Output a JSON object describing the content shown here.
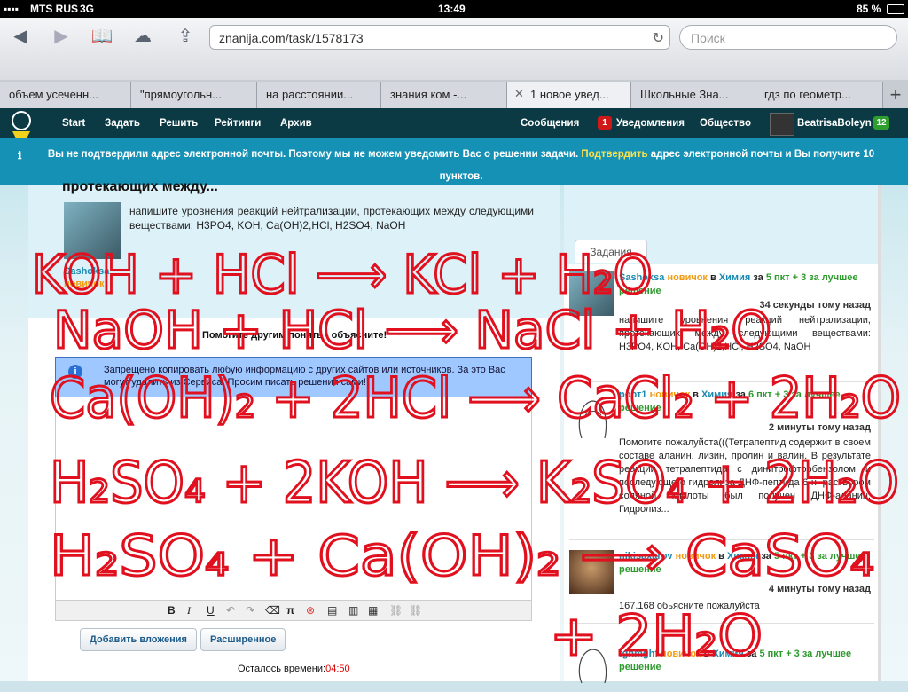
{
  "status_bar": {
    "carrier": "MTS RUS",
    "network": "3G",
    "time": "13:49",
    "battery": "85 %"
  },
  "browser": {
    "url": "znanija.com/task/1578173",
    "search_placeholder": "Поиск",
    "tabs": [
      {
        "label": "объем усеченн..."
      },
      {
        "label": "\"прямоугольн..."
      },
      {
        "label": "на расстоянии..."
      },
      {
        "label": "знания ком -..."
      },
      {
        "label": "1 новое увед..."
      },
      {
        "label": "Школьные Зна..."
      },
      {
        "label": "гдз по геометр..."
      }
    ],
    "add_tab": "+"
  },
  "site_nav": {
    "items": [
      "Start",
      "Задать",
      "Решить",
      "Рейтинги",
      "Архив"
    ],
    "messages": "Сообщения",
    "notifications_count": "1",
    "notifications": "Уведомления",
    "community": "Общество",
    "username": "BeatrisaBoleyn",
    "points": "12"
  },
  "alert": {
    "text_before": "Вы не подтвердили адрес электронной почты. Поэтому мы не можем уведомить Вас о решении задачи.",
    "link": "Подтвердить",
    "text_after": "адрес электронной почты и Вы получите 10 пунктов."
  },
  "question": {
    "title": "протекающих между...",
    "text": "напишите уровнения реакций нейтрализации, протекающих между следующими веществами: H3PO4, KOH, Ca(OH)2,HCl, H2SO4, NaOH",
    "user": "Sashoksa",
    "rank": "новичок"
  },
  "answer_form": {
    "help_title": "Помогите другим понять - объясните!",
    "warning": "Запрещено копировать любую информацию с других сайтов или источников. За это Вас могут удалить из Сервиса. Просим писать решения сами!",
    "attach_button": "Добавить вложения",
    "advanced_button": "Расширенное",
    "time_label": "Осталось времени:",
    "time_value": "04:50"
  },
  "sidebar": {
    "tab": "Задания",
    "tasks": [
      {
        "user": "Sashoksa",
        "rank": "новичок",
        "subject": "Химия",
        "points": "5 пкт + 3 за лучшее решение",
        "time": "34 секунды тому назад",
        "text": "напишите уровнения реакций нейтрализации, протекающих между следующими веществами: H3PO4, KOH, Ca(OH)2,HCl, H2SO4, NaOH"
      },
      {
        "user": "poрт1",
        "rank": "новичок",
        "subject": "Химия",
        "points": "6 пкт + 3 за лучшее решение",
        "time": "2 минуты тому назад",
        "text": "Помогите пожалуйста(((Тетрапептид содержит в своем составе аланин, лизин, пролин и валин. В результате реакции тетрапептида с динитрофторбензолом и последующего гидролиза ДНФ-пептида 6 н. раствором соляной кислоты был получен ДНФ-аланин. Гидролиз..."
      },
      {
        "user": "nikisaxarov",
        "rank": "новичок",
        "subject": "Химия",
        "points": "5 пкт + 3 за лучшее решение",
        "time": "4 минуты тому назад",
        "text": "167.168 обьясните пожалуйста"
      },
      {
        "user": "fghmghf",
        "rank": "новичок",
        "subject": "Химия",
        "points": "5 пкт + 3 за лучшее решение",
        "time": "",
        "text": ""
      }
    ],
    "connector_in": "в",
    "connector_for": "за"
  },
  "handwriting": {
    "line1": "KOH + HCl ⟶ KCl + H₂O",
    "line2": "NaOH + HCl ⟶ NaCl + H₂O",
    "line3": "Ca(OH)₂ + 2HCl ⟶ CaCl₂ + 2H₂O",
    "line4": "H₂SO₄ + 2KOH ⟶ K₂SO₄ + 2H₂O",
    "line5": "H₂SO₄ + Ca(OH)₂ ⟶ CaSO₄",
    "line6": "+ 2H₂O"
  },
  "colors": {
    "header": "#0b3a44",
    "alert": "#1591b5",
    "ink": "#e0101e",
    "link": "#1a8ab0",
    "rank": "#f39a10"
  }
}
